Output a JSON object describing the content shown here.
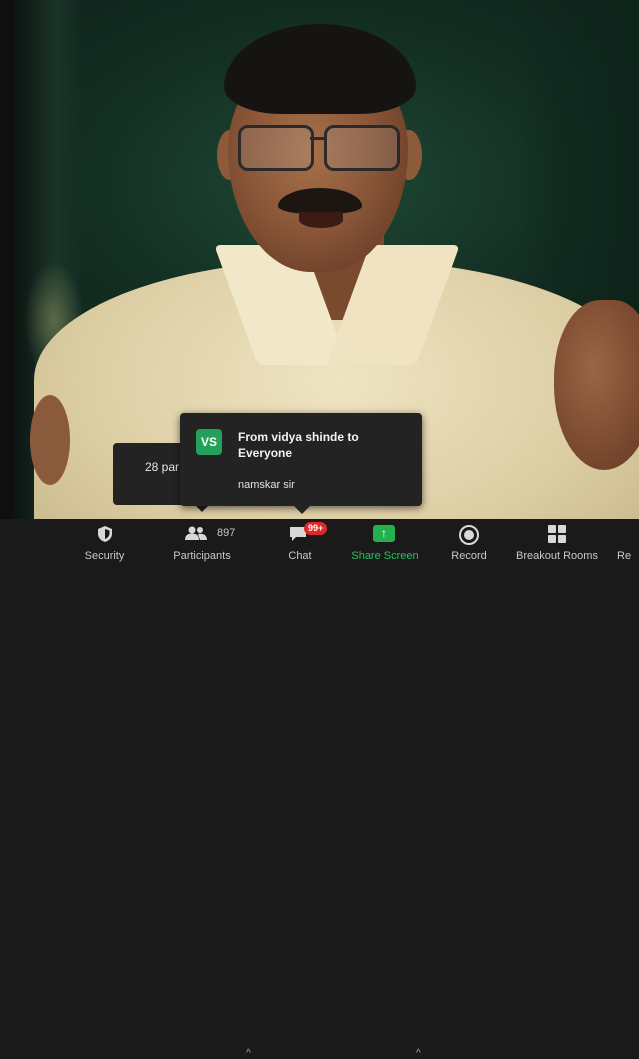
{
  "chat_notification": {
    "avatar_initials": "VS",
    "sender": "From vidya shinde to Everyone",
    "message": "namskar sir"
  },
  "participants_popup": {
    "text": "28 par"
  },
  "toolbar": {
    "security": {
      "label": "Security",
      "icon": "shield-icon"
    },
    "participants": {
      "label": "Participants",
      "count": "897",
      "icon": "participants-icon"
    },
    "chat": {
      "label": "Chat",
      "badge": "99+",
      "icon": "chat-bubble-icon"
    },
    "share_screen": {
      "label": "Share Screen",
      "icon": "share-arrow-icon"
    },
    "record": {
      "label": "Record",
      "icon": "record-icon"
    },
    "breakout_rooms": {
      "label": "Breakout Rooms",
      "icon": "grid-icon"
    },
    "reactions": {
      "label": "Re"
    }
  },
  "colors": {
    "toolbar_bg": "#1a1a1a",
    "share_green": "#22b14c",
    "badge_red": "#e02828",
    "avatar_green": "#23a15b"
  }
}
